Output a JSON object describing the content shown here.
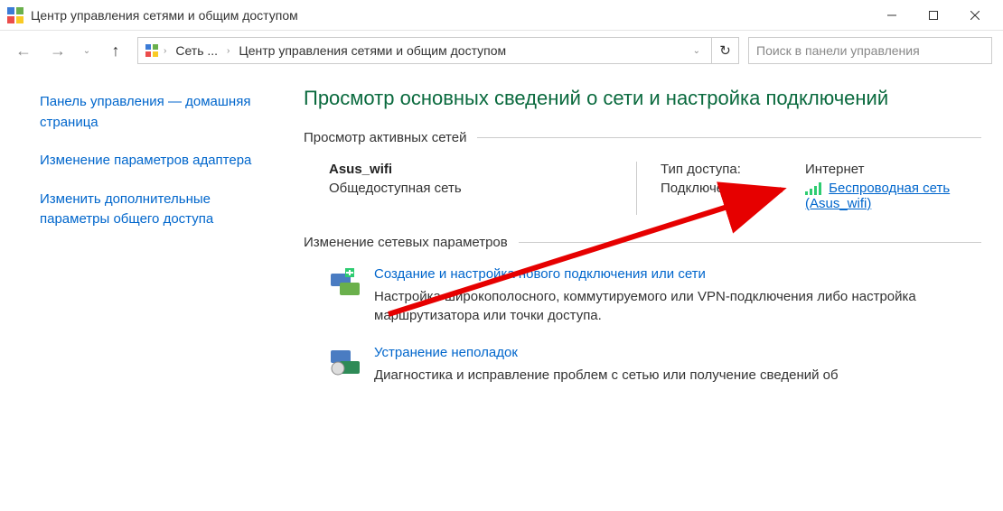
{
  "window": {
    "title": "Центр управления сетями и общим доступом"
  },
  "breadcrumb": {
    "root": "Сеть ...",
    "current": "Центр управления сетями и общим доступом"
  },
  "search": {
    "placeholder": "Поиск в панели управления"
  },
  "sidebar": {
    "items": [
      "Панель управления — домашняя страница",
      "Изменение параметров адаптера",
      "Изменить дополнительные параметры общего доступа"
    ]
  },
  "main": {
    "heading": "Просмотр основных сведений о сети и настройка подключений",
    "active_networks_legend": "Просмотр активных сетей",
    "network": {
      "name": "Asus_wifi",
      "category": "Общедоступная сеть",
      "access_label": "Тип доступа:",
      "access_value": "Интернет",
      "conn_label": "Подключения:",
      "conn_link": "Беспроводная сеть (Asus_wifi)"
    },
    "change_params_legend": "Изменение сетевых параметров",
    "tasks": [
      {
        "title": "Создание и настройка нового подключения или сети",
        "desc": "Настройка широкополосного, коммутируемого или VPN-подключения либо настройка маршрутизатора или точки доступа."
      },
      {
        "title": "Устранение неполадок",
        "desc": "Диагностика и исправление проблем с сетью или получение сведений об"
      }
    ]
  }
}
